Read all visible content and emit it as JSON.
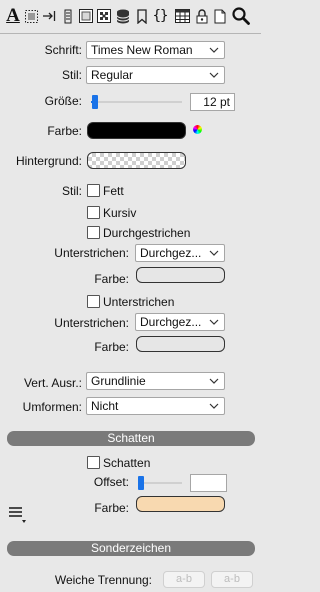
{
  "toolbar": {
    "icons": [
      "text-icon",
      "border-icon",
      "indent-icon",
      "column-icon",
      "frame-icon",
      "pattern-icon",
      "database-icon",
      "bookmark-icon",
      "braces-icon",
      "table-icon",
      "lock-icon",
      "page-icon",
      "search-icon"
    ],
    "text_icon_glyph": "A"
  },
  "font": {
    "schrift_label": "Schrift:",
    "schrift_value": "Times New Roman",
    "stil_label": "Stil:",
    "stil_value": "Regular",
    "groesse_label": "Größe:",
    "groesse_value": "12 pt",
    "farbe_label": "Farbe:",
    "farbe_color": "#000000",
    "hintergrund_label": "Hintergrund:"
  },
  "style": {
    "stil_label": "Stil:",
    "fett": "Fett",
    "kursiv": "Kursiv",
    "durchgestrichen": "Durchgestrichen",
    "unterstrichen1_label": "Unterstrichen:",
    "unterstrichen1_value": "Durchgez...",
    "farbe1_label": "Farbe:",
    "unterstrichen_cb": "Unterstrichen",
    "unterstrichen2_label": "Unterstrichen:",
    "unterstrichen2_value": "Durchgez...",
    "farbe2_label": "Farbe:"
  },
  "align": {
    "vert_label": "Vert. Ausr.:",
    "vert_value": "Grundlinie",
    "umformen_label": "Umformen:",
    "umformen_value": "Nicht"
  },
  "shadow": {
    "section_title": "Schatten",
    "schatten_cb": "Schatten",
    "offset_label": "Offset:",
    "farbe_label": "Farbe:",
    "farbe_color": "#f8d9b0"
  },
  "special": {
    "section_title": "Sonderzeichen",
    "weiche_label": "Weiche Trennung:",
    "btn1": "a-b",
    "btn2": "a-b"
  }
}
